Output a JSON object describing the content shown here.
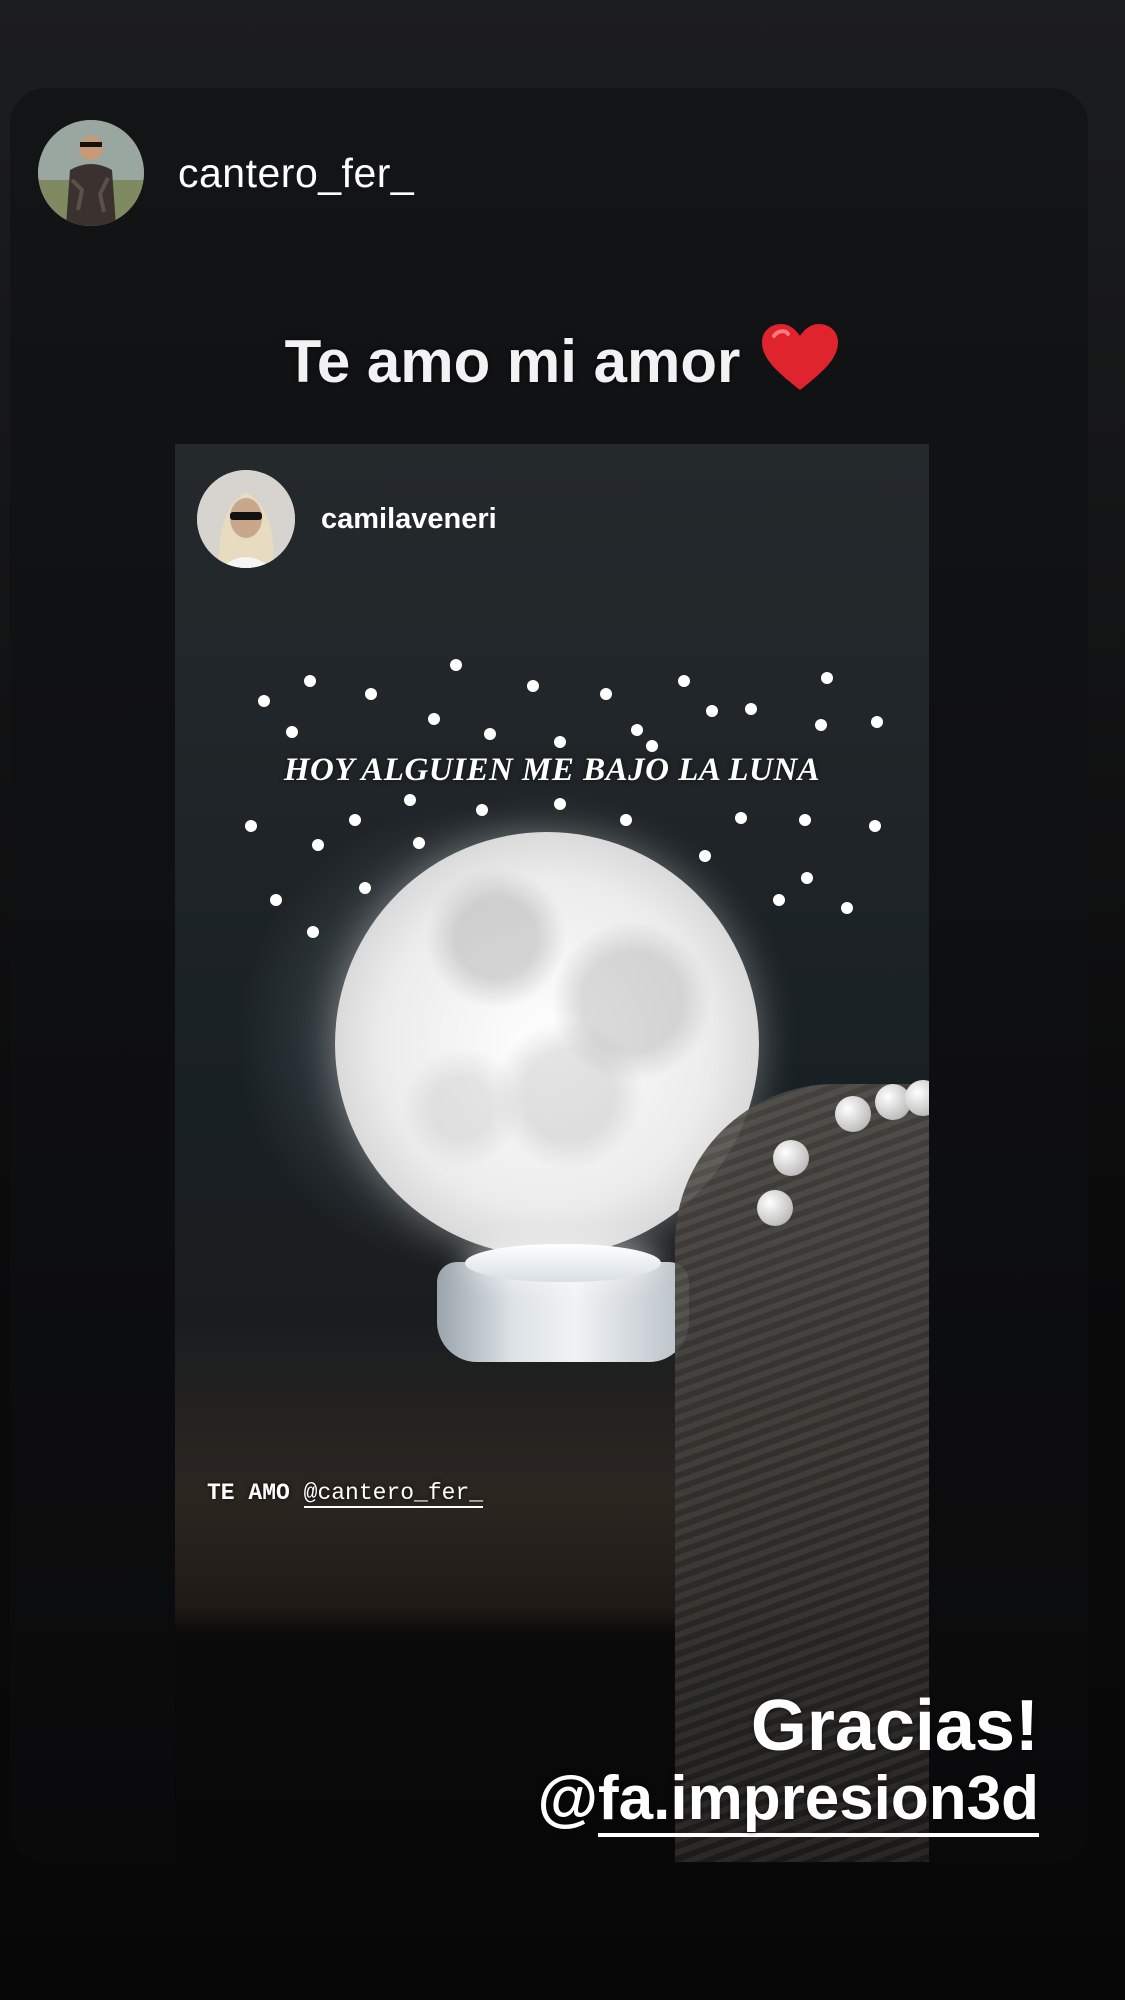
{
  "story": {
    "username": "cantero_fer_",
    "caption_text": "Te amo mi amor",
    "caption_emoji": "red-heart",
    "shared_post": {
      "username": "camilaveneri",
      "headline": "HOY ALGUIEN ME BAJO LA LUNA",
      "mention_prefix": "TE AMO",
      "mention_handle": "@cantero_fer_"
    },
    "thanks_text": "Gracias!",
    "thanks_prefix": "@",
    "thanks_handle": "fa.impresion3d"
  },
  "colors": {
    "background": "#0b0b0c",
    "card": "#0f1012",
    "text": "#ffffff",
    "heart": "#e0242e"
  }
}
